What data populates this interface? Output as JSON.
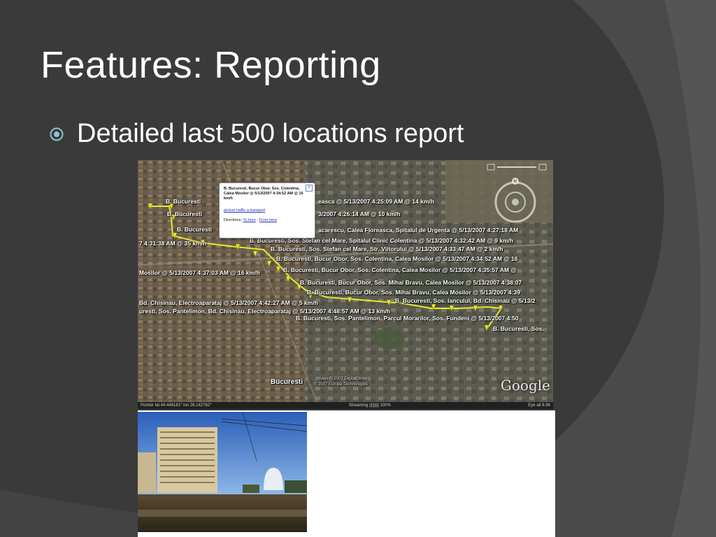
{
  "slide": {
    "title": "Features: Reporting",
    "bullet": "Detailed last 500 locations report"
  },
  "map": {
    "popup": {
      "heading": "B. Bucuresti, Bucur Obor, Sos. Colentina, Calea Mosilor @ 5/13/2007 4:34:52 AM @ 16 km/h",
      "link": "picture traffic a transport",
      "directions_label": "Directions:",
      "to_here": "To here",
      "separator": "-",
      "from_here": "From here",
      "close": "x"
    },
    "labels": [
      "B. Bucuresti",
      "B. Bucuresti",
      "B. Bucuresti",
      "easca @ 5/13/2007 4:25:09 AM @ 14 km/h",
      "3/2007 4:26:14 AM @ 10 km/h",
      "acarescu, Calea Floreasca, Spitalul de Urgenta @ 5/13/2007 4:27:18 AM",
      "7 4:31:38 AM @ 35 km/h",
      "B. Bucuresti, Sos. Stefan cel Mare, Spitalul Clinic Colentina @ 5/13/2007 4:32:42 AM @ 9 km/h",
      "B. Bucuresti, Sos. Stefan cel Mare, Str. Viitorului @ 5/13/2007 4:33:47 AM @ 2 km/h",
      "B. Bucuresti, Bucur Obor, Sos. Colentina, Calea Mosilor @ 5/13/2007 4:34:52 AM @ 16",
      "Mosilor @ 5/13/2007 4:37:03 AM @ 16 km/h",
      "B. Bucuresti, Bucur Obor, Sos. Colentina, Calea Mosilor @ 5/13/2007 4:35:57 AM @",
      "B. Bucuresti, Bucur Obor, Sos. Mihai Bravu, Calea Mosilor @ 5/13/2007 4:38:07",
      "B. Bucuresti, Bucur Obor, Sos. Mihai Bravu, Calea Mosilor @ 5/13/2007 4:39",
      "Bd. Chisinau, Electroaparataj @ 5/13/2007 4:42:27 AM @ 5 km/h",
      "B. Bucuresti, Sos. Iancului, Bd. Chisinau @ 5/13/2",
      "uresti, Sos. Pantelimon, Bd. Chisinau, Electroaparataj @ 5/13/2007 4:48:57 AM @ 13 km/h",
      "B. Bucuresti, Sos. Pantelimon, Parcul Morarilor, Sos. Fundeni @ 5/13/2007 4:50",
      "B. Bucuresti, Sos."
    ],
    "city": "Bucuresti",
    "copyright_1": "Image © 2007 DigitalGlobe",
    "copyright_2": "© 2007 Europa Technologies",
    "logo": "Google",
    "status_left": "Pointer  lat  44.446181°  lon  26.142762°",
    "status_mid": "Streaming ||||||||| 100%",
    "status_right": "Eye alt  6.96"
  },
  "colors": {
    "background": "#3a3a3a",
    "route": "#e8e830",
    "bullet_icon": "#8ec6cf"
  },
  "icons": {
    "bullet": "circled-dot-icon",
    "compass": "navigation-compass-icon",
    "marker": "pushpin-icon"
  }
}
